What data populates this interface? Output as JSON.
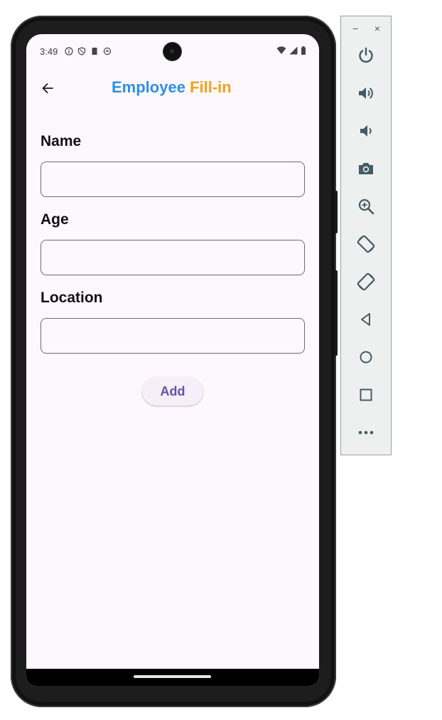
{
  "status_bar": {
    "time": "3:49"
  },
  "app_bar": {
    "title_part1": "Employee",
    "title_part2": "Fill-in"
  },
  "form": {
    "fields": [
      {
        "label": "Name",
        "value": "",
        "placeholder": ""
      },
      {
        "label": "Age",
        "value": "",
        "placeholder": ""
      },
      {
        "label": "Location",
        "value": "",
        "placeholder": ""
      }
    ],
    "add_label": "Add"
  },
  "colors": {
    "title_blue": "#2f8fe6",
    "title_orange": "#f4a01a",
    "button_text": "#6550a6",
    "screen_bg": "#fdf8fd",
    "toolbar_icon": "#455a64"
  },
  "toolbar": {
    "window_controls": {
      "minimize": "−",
      "close": "×"
    },
    "buttons": [
      "power-icon",
      "volume-up-icon",
      "volume-down-icon",
      "camera-icon",
      "zoom-icon",
      "rotate-left-icon",
      "rotate-right-icon",
      "back-icon",
      "home-icon",
      "overview-icon",
      "more-icon"
    ]
  }
}
